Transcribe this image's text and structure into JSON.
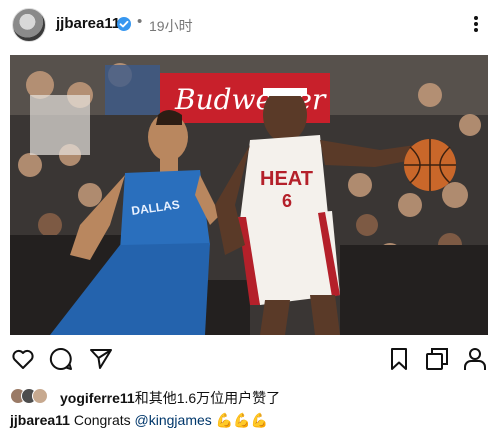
{
  "post": {
    "username": "jjbarea11",
    "dot": "•",
    "time": "19小时",
    "photo_alt": "",
    "likes": {
      "first_liker": "yogiferre11",
      "rest": "和其他1.6万位用户赞了"
    },
    "caption": {
      "username": "jjbarea11",
      "text": "Congrats",
      "mention": "@kingjames",
      "emoji": "💪💪💪"
    },
    "jersey_texts": {
      "heat_word": "HEAT",
      "heat_number": "6",
      "dallas_word": "DALLAS",
      "banner": "Budweiser"
    }
  },
  "colors": {
    "verified": "#3797f0",
    "mention": "#00376b",
    "heat_red": "#b4202a",
    "dallas_blue": "#2a6fbd"
  },
  "icons": {
    "more": "more-icon",
    "like": "heart-icon",
    "comment": "comment-icon",
    "share": "send-icon",
    "save": "bookmark-icon",
    "view": "carousel-icon",
    "profile": "profile-icon"
  }
}
